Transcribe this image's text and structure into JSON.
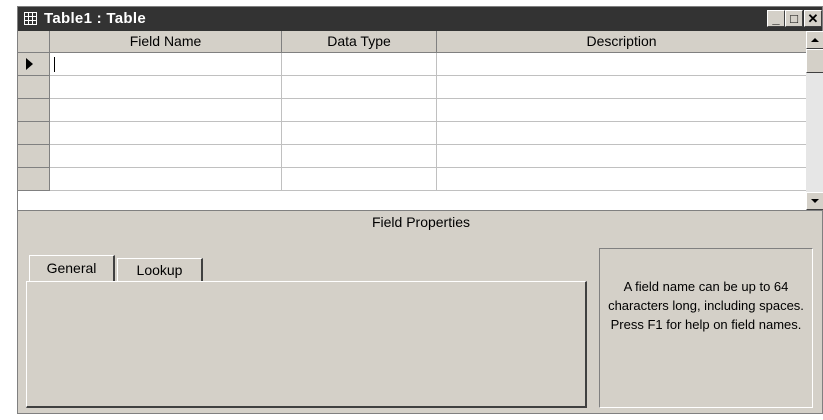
{
  "window": {
    "title": "Table1 : Table",
    "minimize_glyph": "_",
    "restore_glyph": "□",
    "close_glyph": "✕"
  },
  "grid": {
    "columns": [
      "Field Name",
      "Data Type",
      "Description"
    ],
    "rows": [
      {
        "field_name": "",
        "data_type": "",
        "description": "",
        "current": true
      },
      {
        "field_name": "",
        "data_type": "",
        "description": ""
      },
      {
        "field_name": "",
        "data_type": "",
        "description": ""
      },
      {
        "field_name": "",
        "data_type": "",
        "description": ""
      },
      {
        "field_name": "",
        "data_type": "",
        "description": ""
      },
      {
        "field_name": "",
        "data_type": "",
        "description": ""
      }
    ]
  },
  "field_properties": {
    "title": "Field Properties",
    "tabs": [
      "General",
      "Lookup"
    ],
    "active_tab": "General",
    "help_text": "A field name can be up to 64 characters long, including spaces. Press F1 for help on field names."
  },
  "icons": {
    "window": "table-icon",
    "row_selector": "current-row-arrow-icon",
    "scroll_up": "scroll-up-arrow-icon",
    "scroll_down": "scroll-down-arrow-icon"
  }
}
